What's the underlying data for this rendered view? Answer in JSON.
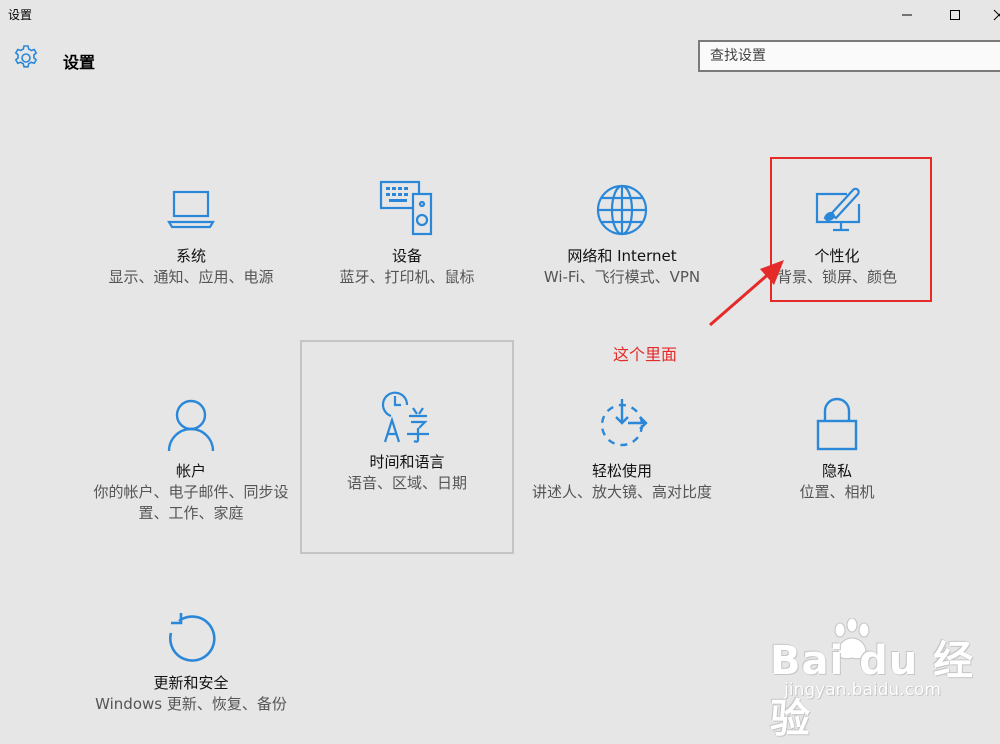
{
  "window": {
    "title": "设置",
    "minimize_label": "Minimize",
    "maximize_label": "Maximize",
    "close_label": "Close"
  },
  "header": {
    "title": "设置",
    "search_placeholder": "查找设置"
  },
  "accent_color": "#2b88d8",
  "tiles": [
    {
      "title": "系统",
      "desc": "显示、通知、应用、电源",
      "icon": "laptop-icon"
    },
    {
      "title": "设备",
      "desc": "蓝牙、打印机、鼠标",
      "icon": "devices-icon"
    },
    {
      "title": "网络和 Internet",
      "desc": "Wi-Fi、飞行模式、VPN",
      "icon": "globe-icon"
    },
    {
      "title": "个性化",
      "desc": "背景、锁屏、颜色",
      "icon": "paint-screen-icon"
    },
    {
      "title": "帐户",
      "desc": "你的帐户、电子邮件、同步设置、工作、家庭",
      "icon": "person-icon"
    },
    {
      "title": "时间和语言",
      "desc": "语音、区域、日期",
      "icon": "time-language-icon"
    },
    {
      "title": "轻松使用",
      "desc": "讲述人、放大镜、高对比度",
      "icon": "ease-of-access-icon"
    },
    {
      "title": "隐私",
      "desc": "位置、相机",
      "icon": "lock-icon"
    },
    {
      "title": "更新和安全",
      "desc": "Windows 更新、恢复、备份",
      "icon": "refresh-icon"
    }
  ],
  "annotation": {
    "text": "这个里面",
    "color": "#e52a2a"
  },
  "watermark": {
    "brand": "Bai du 经验",
    "url": "jingyan.baidu.com"
  }
}
